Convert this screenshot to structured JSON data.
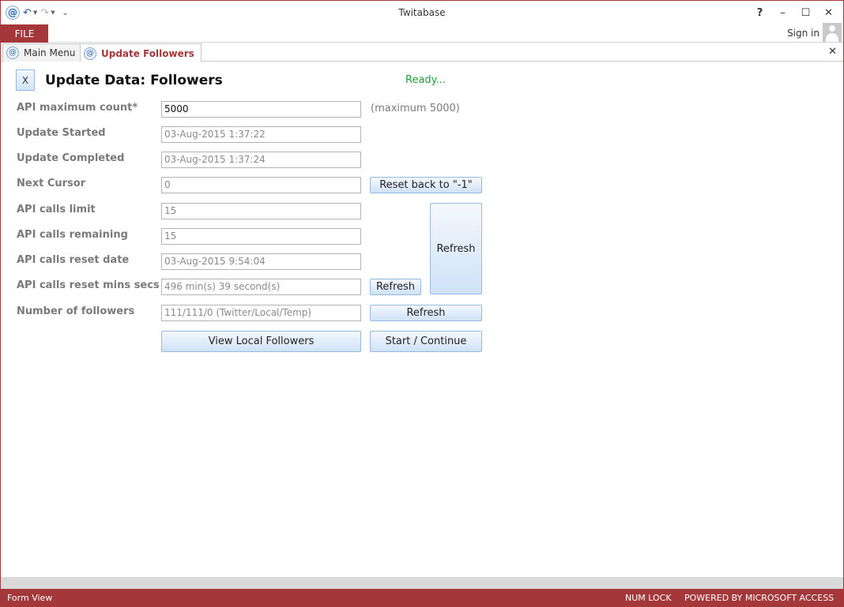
{
  "window": {
    "title": "Twitabase",
    "controls": {
      "help": "?",
      "minimize": "–",
      "maximize": "☐",
      "close": "✕"
    }
  },
  "qat": {
    "undo": "↶",
    "redo": "↷",
    "customize": "⌄"
  },
  "ribbon": {
    "file_label": "FILE",
    "signin_label": "Sign in"
  },
  "tabs": [
    {
      "label": "Main Menu",
      "active": false
    },
    {
      "label": "Update Followers",
      "active": true
    }
  ],
  "doc_close": "✕",
  "form": {
    "close_label": "X",
    "title": "Update Data: Followers",
    "status": "Ready...",
    "fields": {
      "api_max_count": {
        "label": "API maximum count*",
        "value": "5000",
        "hint": "(maximum 5000)"
      },
      "update_started": {
        "label": "Update Started",
        "value": "03-Aug-2015 1:37:22"
      },
      "update_completed": {
        "label": "Update Completed",
        "value": "03-Aug-2015 1:37:24"
      },
      "next_cursor": {
        "label": "Next Cursor",
        "value": "0"
      },
      "api_calls_limit": {
        "label": "API calls limit",
        "value": "15"
      },
      "api_calls_remaining": {
        "label": "API calls remaining",
        "value": "15"
      },
      "api_calls_reset_date": {
        "label": "API calls reset date",
        "value": "03-Aug-2015 9:54:04"
      },
      "api_calls_reset_mins": {
        "label": "API calls reset mins secs",
        "value": "496 min(s) 39 second(s)"
      },
      "number_of_followers": {
        "label": "Number of followers",
        "value": "111/111/0 (Twitter/Local/Temp)"
      }
    },
    "buttons": {
      "reset_cursor": "Reset back to \"-1\"",
      "refresh_api": "Refresh",
      "refresh_reset_mins": "Refresh",
      "refresh_followers": "Refresh",
      "view_local_followers": "View Local Followers",
      "start_continue": "Start / Continue"
    }
  },
  "statusbar": {
    "view": "Form View",
    "num_lock": "NUM LOCK",
    "powered_by": "POWERED BY MICROSOFT ACCESS"
  },
  "colors": {
    "accent": "#a4373a",
    "status_ok": "#1e9e3a",
    "button_border": "#9ab9de"
  }
}
